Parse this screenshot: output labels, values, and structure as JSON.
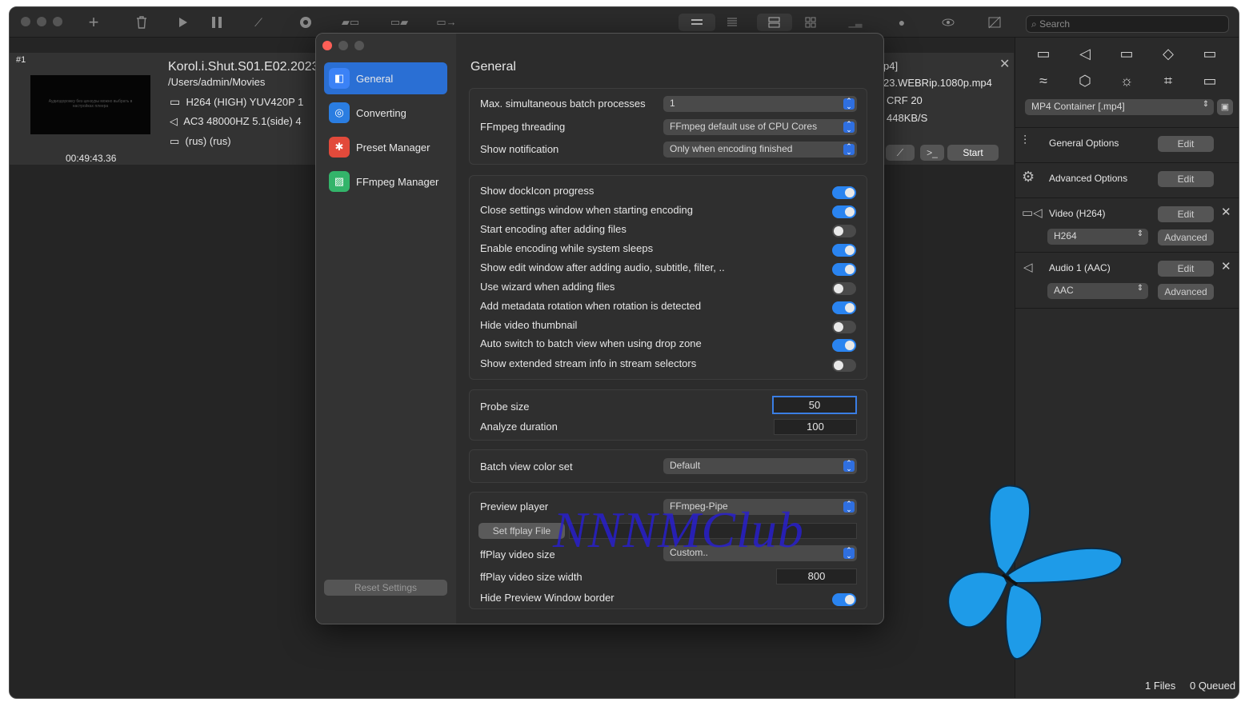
{
  "toolbar": {
    "search_placeholder": "Search",
    "icons": [
      "add-icon",
      "trash-icon",
      "play-icon",
      "pause-icon",
      "wand-icon",
      "record-icon",
      "video-image-icon",
      "image-video-icon",
      "output-icon",
      "list-view-icon",
      "compact-view-icon",
      "batch-view-icon",
      "grid-view-icon",
      "chart-icon",
      "drop-icon",
      "eye-icon",
      "no-image-icon"
    ]
  },
  "file": {
    "index": "#1",
    "title": "Korol.i.Shut.S01.E02.2023",
    "path": "/Users/admin/Movies",
    "video": "H264 (HIGH) YUV420P 1",
    "audio": "AC3 48000HZ 5.1(side) 4",
    "subtitle": "(rus) (rus)",
    "duration": "00:49:43.36",
    "thumb_text": "Аудиодорожку без цензуры можно выбрать в настройках плеера",
    "out_ext": "p4]",
    "out_name": "23.WEBRip.1080p.mp4",
    "out_crf": "CRF 20",
    "out_rate": "448KB/S",
    "cmd_label": ">_",
    "start_label": "Start"
  },
  "side": {
    "container": "MP4 Container [.mp4]",
    "general_options": "General Options",
    "advanced_options": "Advanced Options",
    "video_title": "Video (H264)",
    "video_codec": "H264",
    "audio_title": "Audio 1 (AAC)",
    "audio_codec": "AAC",
    "edit": "Edit",
    "advanced": "Advanced"
  },
  "dialog": {
    "heading": "General",
    "nav": [
      {
        "label": "General",
        "color": "#3b82f6"
      },
      {
        "label": "Converting",
        "color": "#2a7de1"
      },
      {
        "label": "Preset Manager",
        "color": "#e24a3b"
      },
      {
        "label": "FFmpeg Manager",
        "color": "#33b46a"
      }
    ],
    "reset": "Reset Settings",
    "batch_label": "Max. simultaneous batch processes",
    "batch_value": "1",
    "threading_label": "FFmpeg threading",
    "threading_value": "FFmpeg default use of CPU Cores",
    "notify_label": "Show notification",
    "notify_value": "Only when encoding finished",
    "toggles": [
      {
        "label": "Show dockIcon progress",
        "on": true
      },
      {
        "label": "Close settings window when starting encoding",
        "on": true
      },
      {
        "label": "Start encoding after adding files",
        "on": false
      },
      {
        "label": "Enable encoding while system sleeps",
        "on": true
      },
      {
        "label": "Show edit window after adding audio, subtitle, filter, ..",
        "on": true
      },
      {
        "label": "Use wizard when adding files",
        "on": false
      },
      {
        "label": "Add metadata rotation when rotation is detected",
        "on": true
      },
      {
        "label": "Hide video thumbnail",
        "on": false
      },
      {
        "label": "Auto switch to batch view when using drop zone",
        "on": true
      },
      {
        "label": "Show extended stream info in stream selectors",
        "on": false
      }
    ],
    "probe_label": "Probe size",
    "probe_value": "50",
    "analyze_label": "Analyze duration",
    "analyze_value": "100",
    "colorset_label": "Batch view color set",
    "colorset_value": "Default",
    "player_label": "Preview player",
    "player_value": "FFmpeg-Pipe",
    "ffplay_btn": "Set ffplay File",
    "ffplay_size_label": "ffPlay video size",
    "ffplay_size_value": "Custom..",
    "ffplay_width_label": "ffPlay video size width",
    "ffplay_width_value": "800",
    "hide_border_label": "Hide Preview Window border",
    "hide_border_on": true
  },
  "watermark": "NNNMClub",
  "status": {
    "files": "1 Files",
    "queued": "0 Queued"
  },
  "colors": {
    "accent": "#2a84f0",
    "butterfly": "#1e9be8"
  }
}
